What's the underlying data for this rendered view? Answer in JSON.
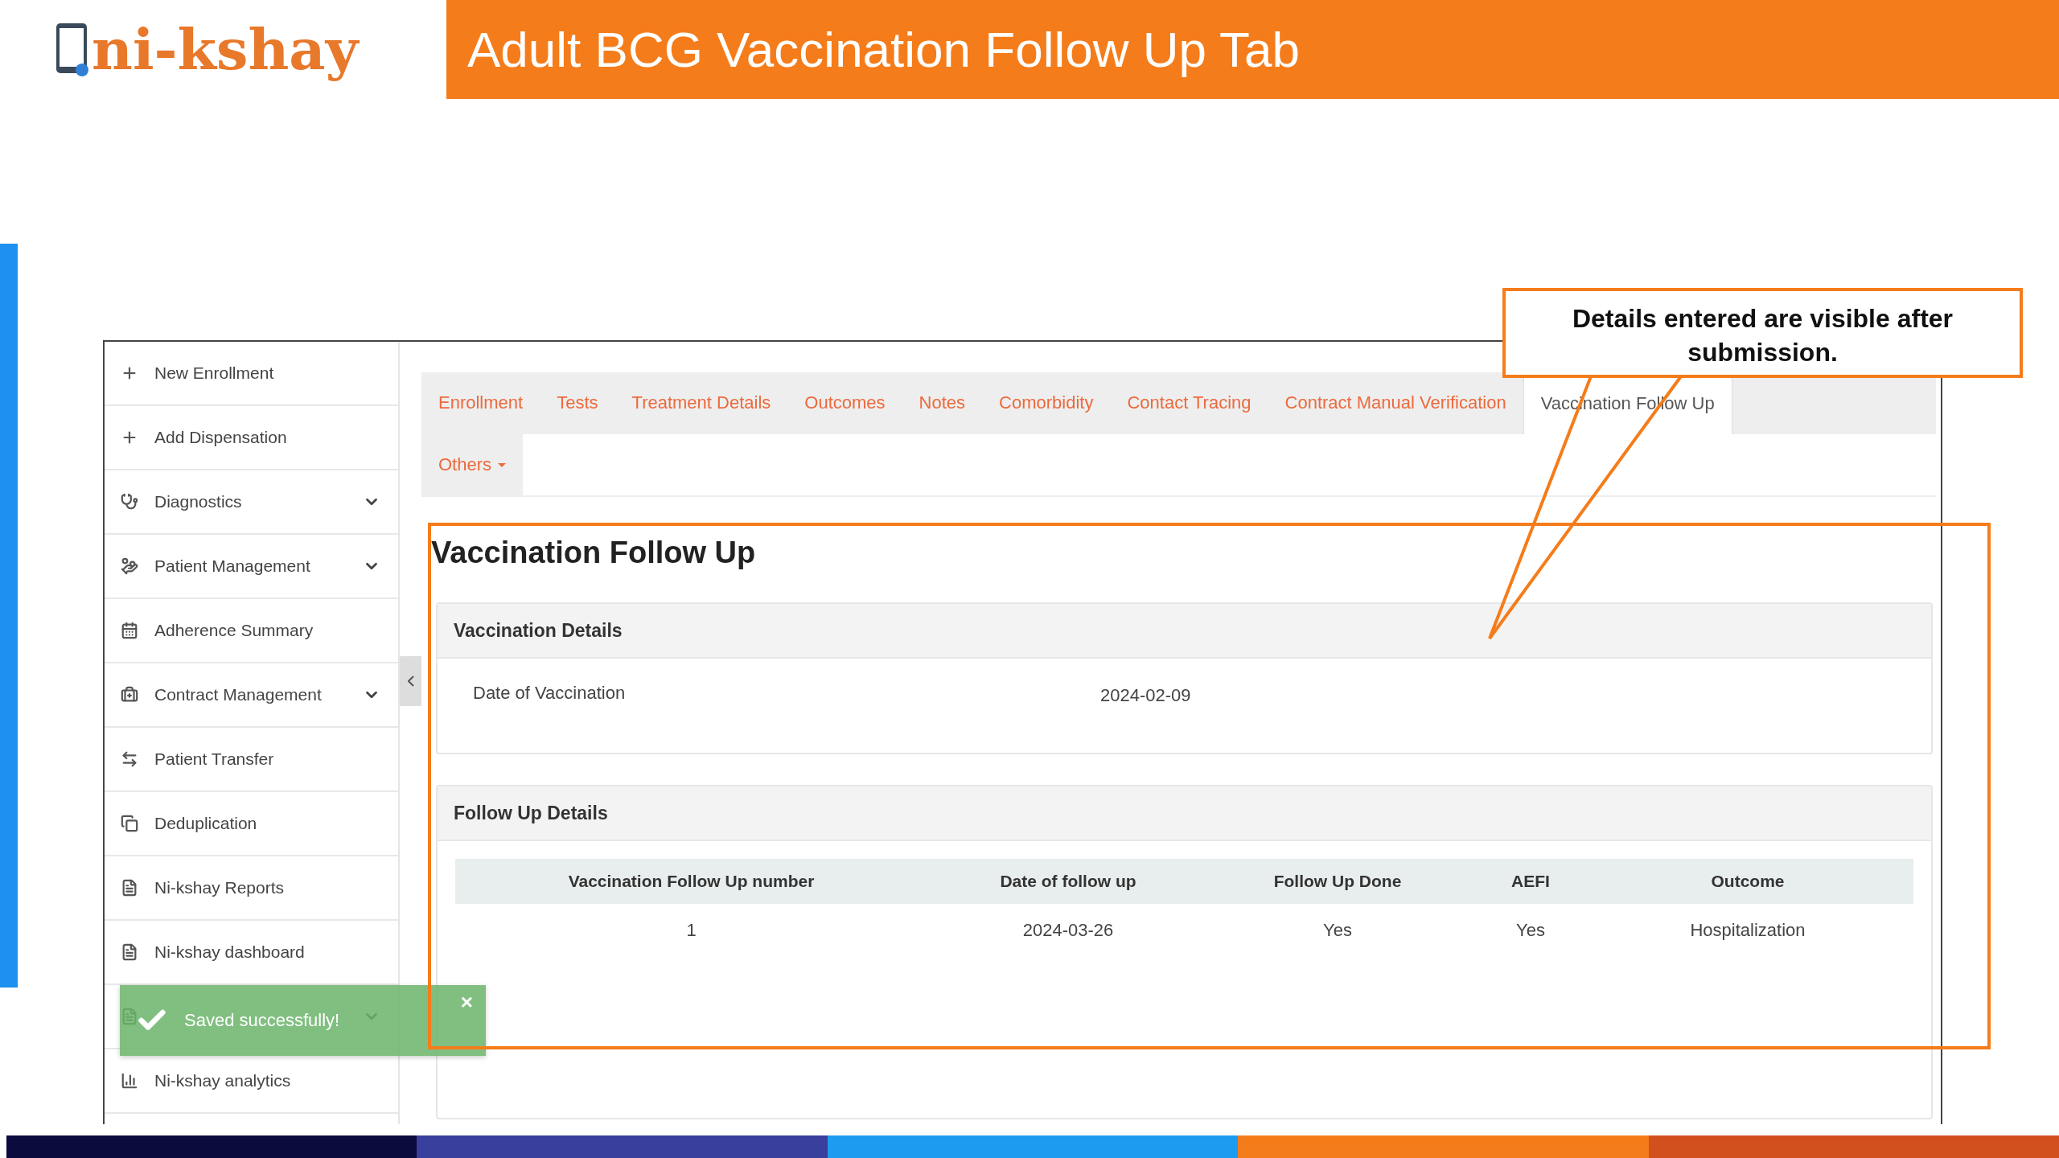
{
  "logo": {
    "text": "ni-kshay"
  },
  "slide_title": "Adult BCG Vaccination Follow Up Tab",
  "sidebar": {
    "items": [
      {
        "label": "New Enrollment",
        "expandable": false
      },
      {
        "label": "Add Dispensation",
        "expandable": false
      },
      {
        "label": "Diagnostics",
        "expandable": true
      },
      {
        "label": "Patient Management",
        "expandable": true
      },
      {
        "label": "Adherence Summary",
        "expandable": false
      },
      {
        "label": "Contract Management",
        "expandable": true
      },
      {
        "label": "Patient Transfer",
        "expandable": false
      },
      {
        "label": "Deduplication",
        "expandable": false
      },
      {
        "label": "Ni-kshay Reports",
        "expandable": false
      },
      {
        "label": "Ni-kshay dashboard",
        "expandable": false
      },
      {
        "expandable": true
      },
      {
        "label": "Ni-kshay analytics",
        "expandable": false
      }
    ]
  },
  "tab_rows": [
    [
      {
        "label": "Enrollment",
        "selected": false,
        "kind": "tab"
      },
      {
        "label": "Tests",
        "selected": false,
        "kind": "tab"
      },
      {
        "label": "Treatment Details",
        "selected": false,
        "kind": "tab"
      },
      {
        "label": "Outcomes",
        "selected": false,
        "kind": "tab"
      },
      {
        "label": "Notes",
        "selected": false,
        "kind": "tab"
      },
      {
        "label": "Comorbidity",
        "selected": false,
        "kind": "tab"
      },
      {
        "label": "Contact Tracing",
        "selected": false,
        "kind": "tab"
      },
      {
        "label": "Contract Manual Verification",
        "selected": false,
        "kind": "tab"
      },
      {
        "label": "Vaccination Follow Up",
        "selected": true,
        "kind": "tab"
      }
    ],
    [
      {
        "label": "Others",
        "selected": false,
        "kind": "dropdown"
      }
    ]
  ],
  "page_heading": "Vaccination Follow Up",
  "vaccination_details": {
    "title": "Vaccination Details",
    "fields": [
      {
        "label": "Date of Vaccination",
        "value": "2024-02-09"
      }
    ]
  },
  "follow_up_details": {
    "title": "Follow Up Details",
    "table": {
      "columns": [
        "Vaccination Follow Up number",
        "Date of follow up",
        "Follow Up Done",
        "AEFI",
        "Outcome"
      ],
      "rows": [
        [
          "1",
          "2024-03-26",
          "Yes",
          "Yes",
          "Hospitalization"
        ]
      ]
    }
  },
  "toast": {
    "message": "Saved successfully!",
    "close": "×"
  },
  "callout": {
    "text": "Details entered are visible after submission."
  }
}
